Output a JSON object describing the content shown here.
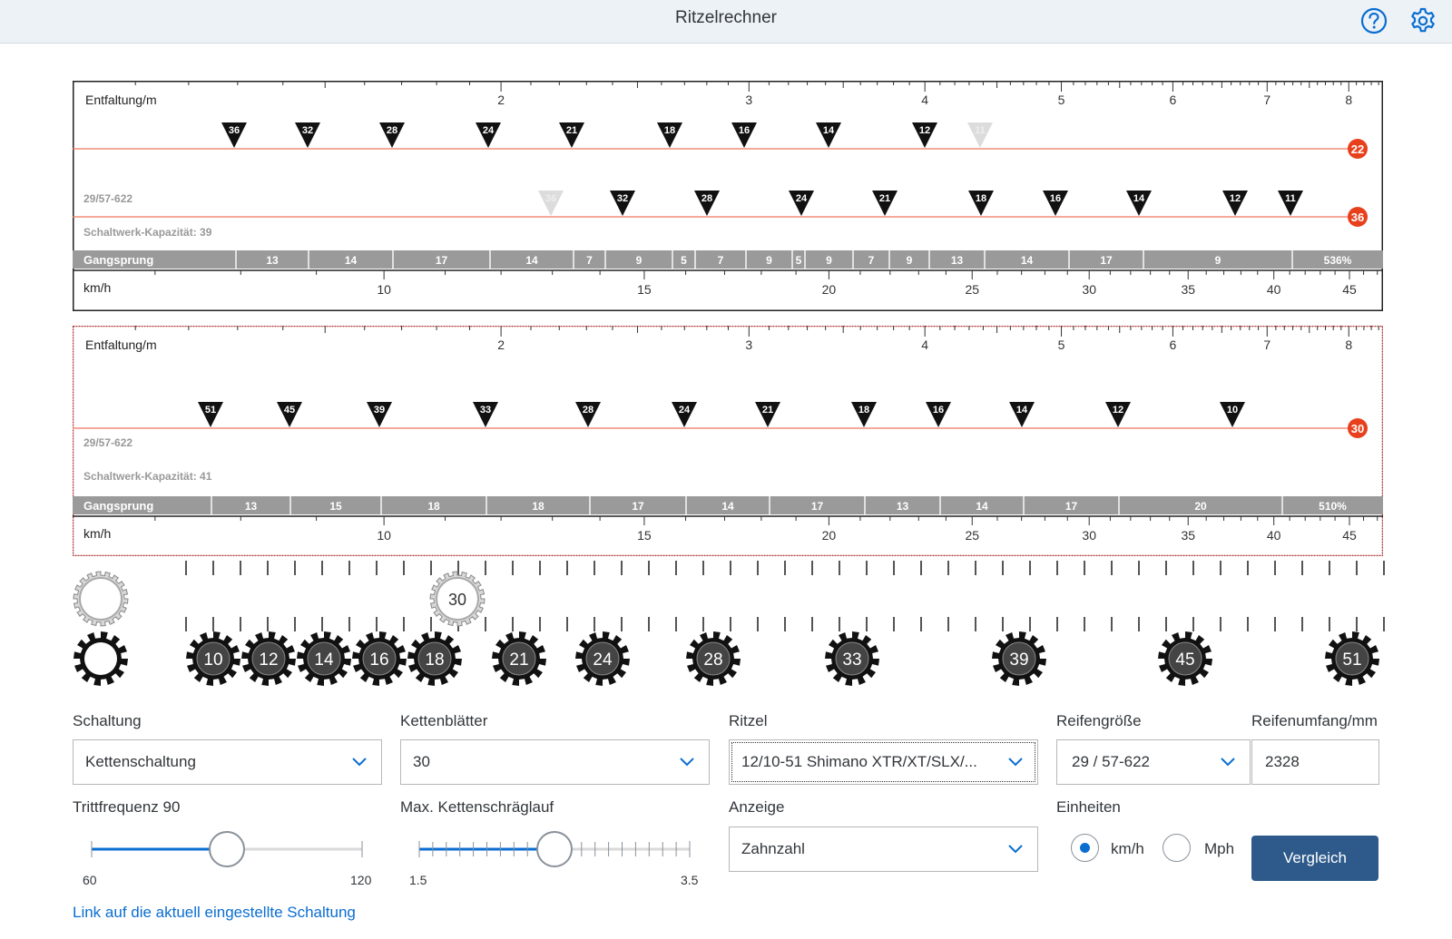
{
  "header": {
    "title": "Ritzelrechner",
    "help_icon": "help-circle-icon",
    "settings_icon": "gear-icon"
  },
  "charts": [
    {
      "label_top": "Entfaltung/m",
      "scale_top": [
        "2",
        "3",
        "4",
        "5",
        "6",
        "7",
        "8"
      ],
      "chainrings": [
        {
          "teeth": "22",
          "sprockets": [
            {
              "t": "36",
              "faded": false
            },
            {
              "t": "32",
              "faded": false
            },
            {
              "t": "28",
              "faded": false
            },
            {
              "t": "24",
              "faded": false
            },
            {
              "t": "21",
              "faded": false
            },
            {
              "t": "18",
              "faded": false
            },
            {
              "t": "16",
              "faded": false
            },
            {
              "t": "14",
              "faded": false
            },
            {
              "t": "12",
              "faded": false
            },
            {
              "t": "11",
              "faded": true
            }
          ]
        },
        {
          "teeth": "36",
          "sprockets": [
            {
              "t": "36",
              "faded": true
            },
            {
              "t": "32",
              "faded": false
            },
            {
              "t": "28",
              "faded": false
            },
            {
              "t": "24",
              "faded": false
            },
            {
              "t": "21",
              "faded": false
            },
            {
              "t": "18",
              "faded": false
            },
            {
              "t": "16",
              "faded": false
            },
            {
              "t": "14",
              "faded": false
            },
            {
              "t": "12",
              "faded": false
            },
            {
              "t": "11",
              "faded": false
            }
          ]
        }
      ],
      "tire": "29/57-622",
      "capacity": "Schaltwerk-Kapazität: 39",
      "gangsprung_label": "Gangsprung",
      "gangsprung": [
        "13",
        "14",
        "17",
        "14",
        "7",
        "9",
        "5",
        "7",
        "9",
        "5",
        "9",
        "7",
        "9",
        "13",
        "14",
        "17",
        "9"
      ],
      "gangsprung_total": "536%",
      "label_bottom": "km/h",
      "scale_bottom": [
        "10",
        "15",
        "20",
        "25",
        "30",
        "35",
        "40",
        "45"
      ],
      "selected": false
    },
    {
      "label_top": "Entfaltung/m",
      "scale_top": [
        "2",
        "3",
        "4",
        "5",
        "6",
        "7",
        "8"
      ],
      "chainrings": [
        {
          "teeth": "30",
          "sprockets": [
            {
              "t": "51",
              "faded": false
            },
            {
              "t": "45",
              "faded": false
            },
            {
              "t": "39",
              "faded": false
            },
            {
              "t": "33",
              "faded": false
            },
            {
              "t": "28",
              "faded": false
            },
            {
              "t": "24",
              "faded": false
            },
            {
              "t": "21",
              "faded": false
            },
            {
              "t": "18",
              "faded": false
            },
            {
              "t": "16",
              "faded": false
            },
            {
              "t": "14",
              "faded": false
            },
            {
              "t": "12",
              "faded": false
            },
            {
              "t": "10",
              "faded": false
            }
          ]
        }
      ],
      "tire": "29/57-622",
      "capacity": "Schaltwerk-Kapazität: 41",
      "gangsprung_label": "Gangsprung",
      "gangsprung": [
        "13",
        "15",
        "18",
        "18",
        "17",
        "14",
        "17",
        "13",
        "14",
        "17",
        "20"
      ],
      "gangsprung_total": "510%",
      "label_bottom": "km/h",
      "scale_bottom": [
        "10",
        "15",
        "20",
        "25",
        "30",
        "35",
        "40",
        "45"
      ],
      "selected": true
    }
  ],
  "gears": {
    "chainring": "30",
    "cassette": [
      "10",
      "12",
      "14",
      "16",
      "18",
      "21",
      "24",
      "28",
      "33",
      "39",
      "45",
      "51"
    ]
  },
  "form": {
    "schaltung": {
      "label": "Schaltung",
      "value": "Kettenschaltung"
    },
    "kettenblaetter": {
      "label": "Kettenblätter",
      "value": "30"
    },
    "ritzel": {
      "label": "Ritzel",
      "value": "12/10-51 Shimano XTR/XT/SLX/..."
    },
    "reifengroesse": {
      "label": "Reifengröße",
      "value": "29 / 57-622"
    },
    "reifenumfang": {
      "label": "Reifenumfang/mm",
      "value": "2328"
    },
    "trittfrequenz": {
      "label": "Trittfrequenz 90",
      "min": "60",
      "max": "120",
      "value": 90,
      "range": [
        60,
        120
      ]
    },
    "kettenschraeglauf": {
      "label": "Max. Kettenschräglauf",
      "min": "1.5",
      "max": "3.5",
      "value": 2.5,
      "range": [
        1.5,
        3.5
      ]
    },
    "anzeige": {
      "label": "Anzeige",
      "value": "Zahnzahl"
    },
    "einheiten": {
      "label": "Einheiten",
      "option_kmh": "km/h",
      "option_mph": "Mph",
      "selected": "km/h"
    },
    "compare_button": "Vergleich",
    "link": "Link auf die aktuell eingestellte Schaltung"
  },
  "colors": {
    "accent": "#0a6ed1",
    "button": "#2d5a8a",
    "chainring_line": "#f0765a",
    "chainring_badge": "#e8401c",
    "gangsprung_bar": "#9a9a9a"
  }
}
